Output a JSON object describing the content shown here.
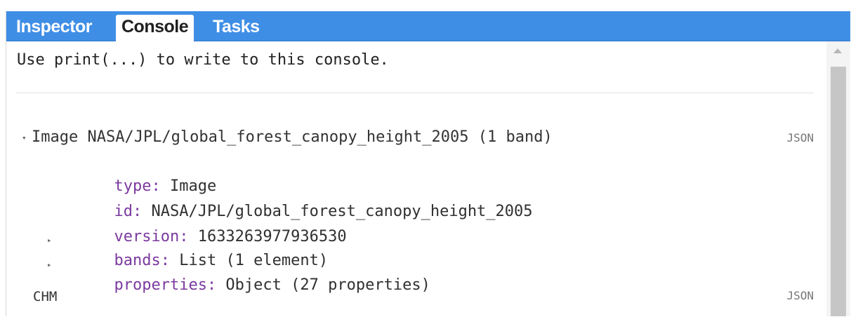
{
  "tabs": {
    "inspector": "Inspector",
    "console": "Console",
    "tasks": "Tasks"
  },
  "console": {
    "hint": "Use print(...) to write to this console.",
    "entries": [
      {
        "summary": "Image NASA/JPL/global_forest_canopy_height_2005 (1 band)",
        "json_label": "JSON",
        "fields": [
          {
            "key": "type:",
            "value": " Image"
          },
          {
            "key": "id:",
            "value": " NASA/JPL/global_forest_canopy_height_2005"
          },
          {
            "key": "version:",
            "value": " 1633263977936530"
          }
        ],
        "collapsed": [
          {
            "key": "bands:",
            "value": " List (1 element)"
          },
          {
            "key": "properties:",
            "value": " Object (27 properties)"
          }
        ]
      },
      {
        "summary": "CHM",
        "json_label": "JSON"
      }
    ]
  },
  "icons": {
    "expanded": "▾",
    "collapsed": "▸"
  },
  "colors": {
    "tab_bar": "#3f8ee6",
    "key": "#7b3aa0"
  }
}
